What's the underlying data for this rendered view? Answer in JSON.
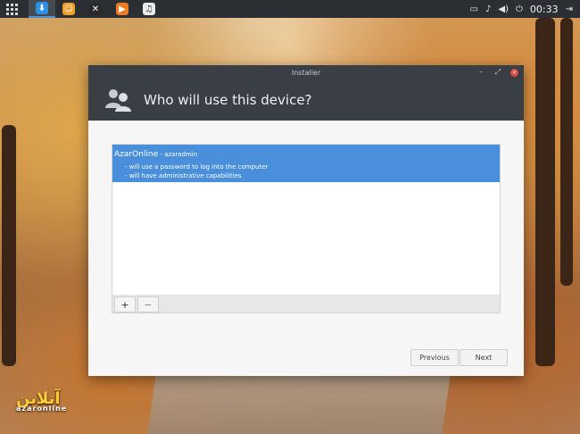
{
  "panel": {
    "launchers": [
      {
        "name": "installer-icon",
        "glyph": "⬇",
        "color": "#2f8fe0",
        "active": true
      },
      {
        "name": "firefox-icon",
        "glyph": "☺",
        "color": "#f39c23",
        "active": false
      },
      {
        "name": "xmms-icon",
        "glyph": "✕",
        "color": "#2a2a2a",
        "active": false
      },
      {
        "name": "media-player-icon",
        "glyph": "▶",
        "color": "#f07a22",
        "active": false
      },
      {
        "name": "music-icon",
        "glyph": "♫",
        "color": "#e9e9e9",
        "active": false
      }
    ],
    "clock": "00:33"
  },
  "window": {
    "title": "Installer",
    "heading": "Who will use this device?"
  },
  "user": {
    "name": "AzarOnline",
    "login": " - azaradmin",
    "lines": [
      "- will use a password to log into the computer",
      "- will have administrative capabilities"
    ]
  },
  "toolbar": {
    "add_label": "+",
    "remove_label": "−"
  },
  "buttons": {
    "previous_label": "Previous",
    "next_label": "Next"
  }
}
